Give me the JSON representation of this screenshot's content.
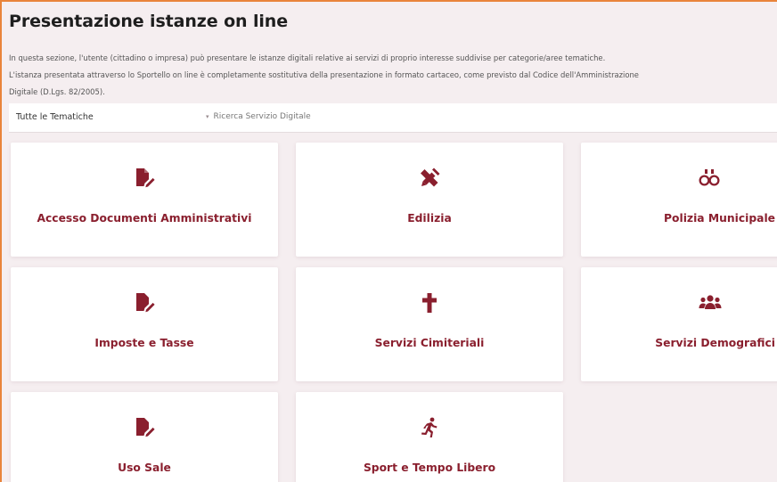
{
  "page": {
    "title": "Presentazione istanze on line",
    "intro_lines": [
      "In questa sezione, l'utente (cittadino o impresa) può presentare le istanze digitali relative ai servizi di proprio interesse suddivise per categorie/aree tematiche.",
      "L'istanza presentata attraverso lo Sportello on line è completamente sostitutiva della presentazione in formato cartaceo, come previsto dal Codice dell'Amministrazione",
      "Digitale (D.Lgs. 82/2005)."
    ]
  },
  "filters": {
    "thematic_select": "Tutte le Tematiche",
    "search_label": "Ricerca Servizio Digitale",
    "search_caret": "▾"
  },
  "categories": [
    {
      "label": "Accesso Documenti Amministrativi",
      "icon": "file-signature-icon"
    },
    {
      "label": "Edilizia",
      "icon": "pencil-ruler-icon"
    },
    {
      "label": "Polizia Municipale",
      "icon": "binoculars-icon"
    },
    {
      "label": "Imposte e Tasse",
      "icon": "file-signature-icon"
    },
    {
      "label": "Servizi Cimiteriali",
      "icon": "cross-icon"
    },
    {
      "label": "Servizi Demografici",
      "icon": "users-icon"
    },
    {
      "label": "Uso Sale",
      "icon": "file-signature-icon"
    },
    {
      "label": "Sport e Tempo Libero",
      "icon": "running-icon"
    }
  ],
  "colors": {
    "accent": "#8a1f2e",
    "background": "#f5eef0",
    "frame_border": "#e9843a"
  }
}
